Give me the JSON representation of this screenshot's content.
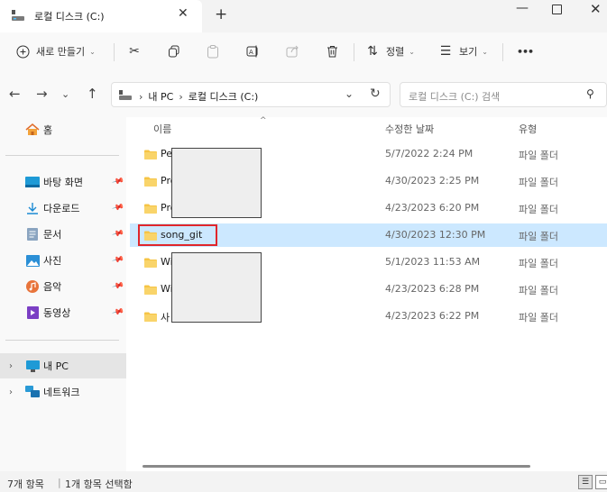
{
  "window": {
    "tab_title": "로컬 디스크 (C:)",
    "close_tab": "✕",
    "new_tab": "+",
    "minimize": "—",
    "close": "✕"
  },
  "toolbar": {
    "new_label": "새로 만들기",
    "sort_label": "정렬",
    "view_label": "보기",
    "more_label": "•••"
  },
  "address": {
    "crumbs": [
      "내 PC",
      "로컬 디스크 (C:)"
    ],
    "search_placeholder": "로컬 디스크 (C:) 검색"
  },
  "sidebar": {
    "home": "홈",
    "quick": [
      {
        "label": "바탕 화면",
        "icon": "desktop-icon"
      },
      {
        "label": "다운로드",
        "icon": "download-icon"
      },
      {
        "label": "문서",
        "icon": "document-icon"
      },
      {
        "label": "사진",
        "icon": "picture-icon"
      },
      {
        "label": "음악",
        "icon": "music-icon"
      },
      {
        "label": "동영상",
        "icon": "video-icon"
      }
    ],
    "this_pc": "내 PC",
    "network": "네트워크"
  },
  "columns": {
    "name": "이름",
    "date": "수정한 날짜",
    "type": "유형"
  },
  "files": [
    {
      "name": "Pe",
      "date": "5/7/2022 2:24 PM",
      "type": "파일 폴더"
    },
    {
      "name": "Pro",
      "date": "4/30/2023 2:25 PM",
      "type": "파일 폴더"
    },
    {
      "name": "Pro",
      "date": "4/23/2023 6:20 PM",
      "type": "파일 폴더"
    },
    {
      "name": "song_git",
      "date": "4/30/2023 12:30 PM",
      "type": "파일 폴더"
    },
    {
      "name": "Wi",
      "date": "5/1/2023 11:53 AM",
      "type": "파일 폴더"
    },
    {
      "name": "Wi",
      "date": "4/23/2023 6:28 PM",
      "type": "파일 폴더"
    },
    {
      "name": "사",
      "date": "4/23/2023 6:22 PM",
      "type": "파일 폴더"
    }
  ],
  "status": {
    "count": "7개 항목",
    "selected": "1개 항목 선택함"
  },
  "colors": {
    "selection": "#cce8ff",
    "highlight_border": "#e0262b",
    "folder": "#f6c445"
  }
}
